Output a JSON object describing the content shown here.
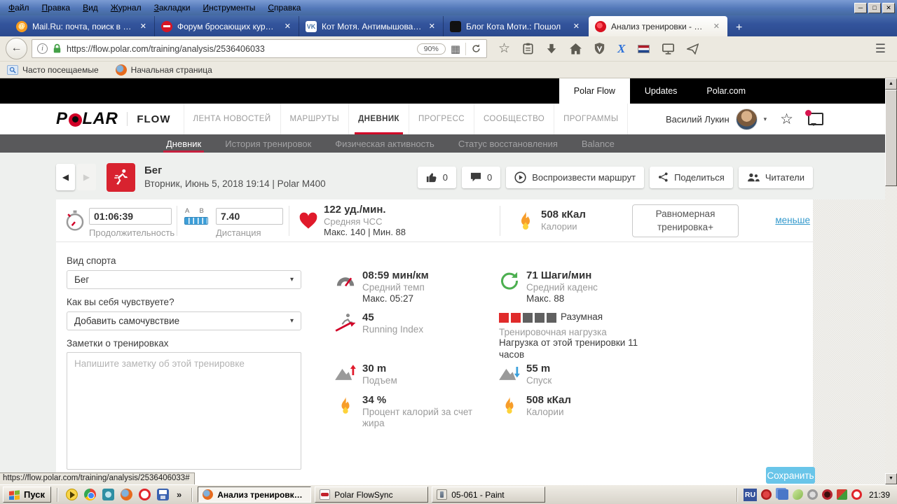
{
  "browser": {
    "menu": [
      "Файл",
      "Правка",
      "Вид",
      "Журнал",
      "Закладки",
      "Инструменты",
      "Справка"
    ],
    "tabs": [
      {
        "title": "Mail.Ru: почта, поиск в инт…",
        "favicon": "mailru-icon",
        "fav_glyph": "@"
      },
      {
        "title": "Форум бросающих курить",
        "favicon": "no-smoking-icon"
      },
      {
        "title": "Кот Мотя. Антимышовая ко…",
        "favicon": "vk-icon",
        "fav_glyph": "VK"
      },
      {
        "title": "Блог Кота Моти.: Пошол",
        "favicon": "black-cat-icon"
      },
      {
        "title": "Анализ тренировки - Polar F…",
        "favicon": "polar-icon"
      }
    ],
    "address": {
      "url": "https://flow.polar.com/training/analysis/2536406033",
      "zoom": "90%"
    },
    "bookmarks_bar": {
      "frequent": "Часто посещаемые",
      "home": "Начальная страница"
    },
    "status_url": "https://flow.polar.com/training/analysis/2536406033#"
  },
  "polar": {
    "topbar": {
      "flow": "Polar Flow",
      "updates": "Updates",
      "site": "Polar.com"
    },
    "brand": {
      "p": "P",
      "lar": "LAR",
      "app": "FLOW"
    },
    "nav": [
      "ЛЕНТА НОВОСТЕЙ",
      "МАРШРУТЫ",
      "ДНЕВНИК",
      "ПРОГРЕСС",
      "СООБЩЕСТВО",
      "ПРОГРАММЫ"
    ],
    "user": {
      "name": "Василий Лукин"
    },
    "subnav": [
      "Дневник",
      "История тренировок",
      "Физическая активность",
      "Статус восстановления",
      "Balance"
    ],
    "session": {
      "sport": "Бег",
      "subtitle": "Вторник, Июнь 5, 2018 19:14 | Polar M400",
      "likes": "0",
      "comments": "0",
      "play": "Воспроизвести маршрут",
      "share": "Поделиться",
      "readers": "Читатели"
    },
    "summary": {
      "duration_value": "01:06:39",
      "duration_label": "Продолжительность",
      "ab": "A B",
      "distance_value": "7.40",
      "distance_label": "Дистанция",
      "hr_value": "122 уд./мин.",
      "hr_label": "Средняя ЧСС",
      "hr_minmax": "Макс. 140 | Мин. 88",
      "cal_value": "508 кКал",
      "cal_label": "Калории",
      "benefit": "Равномерная тренировка+",
      "less": "меньше"
    },
    "form": {
      "sport_label": "Вид спорта",
      "sport_value": "Бег",
      "feel_label": "Как вы себя чувствуете?",
      "feel_value": "Добавить самочувствие",
      "notes_label": "Заметки о тренировках",
      "notes_placeholder": "Напишите заметку об этой тренировке"
    },
    "stats": {
      "pace_value": "08:59 мин/км",
      "pace_label": "Средний темп",
      "pace_max": "Макс. 05:27",
      "ri_value": "45",
      "ri_label": "Running Index",
      "ascent_value": "30 m",
      "ascent_label": "Подъем",
      "fat_value": "34 %",
      "fat_label": "Процент калорий за счет жира",
      "cadence_value": "71 Шаги/мин",
      "cadence_label": "Средний каденс",
      "cadence_max": "Макс. 88",
      "load_rating": "Разумная",
      "load_label": "Тренировочная нагрузка",
      "load_extra": "Нагрузка от этой тренировки 11 часов",
      "load_filled": 2,
      "load_total": 5,
      "descent_value": "55 m",
      "descent_label": "Спуск",
      "cal2_value": "508 кКал",
      "cal2_label": "Калории"
    },
    "save": "Сохранить"
  },
  "taskbar": {
    "start": "Пуск",
    "windows": [
      {
        "label": "Анализ тренировки - ..."
      },
      {
        "label": "Polar FlowSync"
      },
      {
        "label": "05-061 - Paint"
      }
    ],
    "lang": "RU",
    "time": "21:39"
  },
  "icons": {
    "back": "←",
    "close": "✕",
    "new_tab": "+",
    "minimize": "─",
    "restore": "□",
    "close_win": "✕",
    "menu": "☰",
    "star": "☆",
    "overflow": "»",
    "caret_down": "▾",
    "prev": "◀",
    "next": "▶",
    "grid": "▦"
  },
  "colors": {
    "polar_red": "#d10027",
    "sport_badge_red": "#d8232f",
    "link_blue": "#3399cc",
    "save_button_blue": "#69c5e9",
    "load_filled_red": "#e02b2b",
    "load_empty_gray": "#606060",
    "subnav_gray": "#59595b"
  }
}
